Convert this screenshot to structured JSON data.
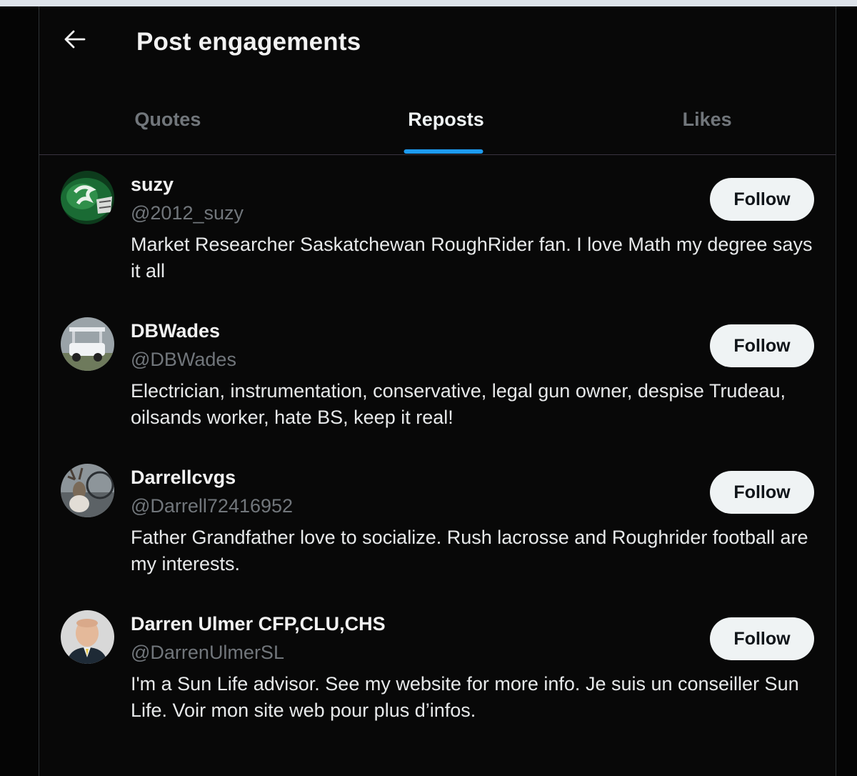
{
  "header": {
    "back_icon": "arrow-left-icon",
    "title": "Post engagements"
  },
  "tabs": [
    {
      "label": "Quotes",
      "active": false
    },
    {
      "label": "Reposts",
      "active": true
    },
    {
      "label": "Likes",
      "active": false
    }
  ],
  "users": [
    {
      "name": "suzy",
      "handle": "@2012_suzy",
      "bio": "Market Researcher Saskatchewan RoughRider fan. I love Math my degree says it all",
      "follow_label": "Follow"
    },
    {
      "name": "DBWades",
      "handle": "@DBWades",
      "bio": "Electrician, instrumentation, conservative, legal gun owner, despise Trudeau, oilsands worker, hate BS, keep it real!",
      "follow_label": "Follow"
    },
    {
      "name": "Darrellcvgs",
      "handle": "@Darrell72416952",
      "bio": "Father Grandfather love to socialize. Rush lacrosse and Roughrider football are my interests.",
      "follow_label": "Follow"
    },
    {
      "name": "Darren Ulmer CFP,CLU,CHS",
      "handle": "@DarrenUlmerSL",
      "bio": "I'm a Sun Life advisor. See my website for more info. Je suis un conseiller Sun Life. Voir mon site web pour plus d’infos.",
      "follow_label": "Follow"
    }
  ],
  "colors": {
    "background": "#080808",
    "accent": "#1d9bf0",
    "muted_text": "#71767b",
    "button_bg": "#eff3f4"
  }
}
